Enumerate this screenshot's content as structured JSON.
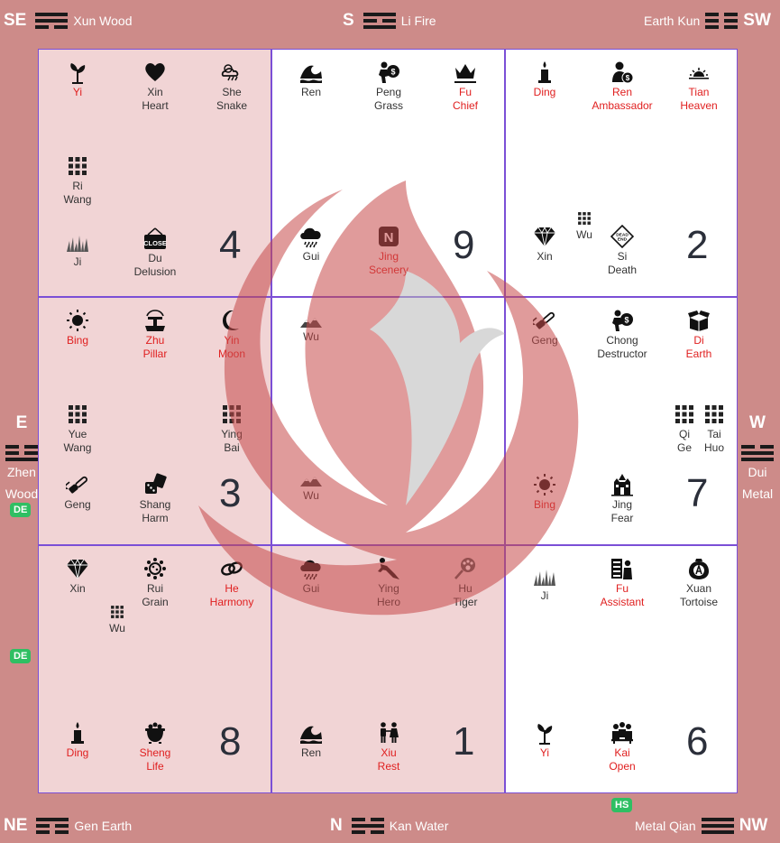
{
  "corners": {
    "se": {
      "dir": "SE",
      "label": "Xun Wood"
    },
    "s": {
      "dir": "S",
      "label": "Li Fire"
    },
    "sw": {
      "dir": "SW",
      "label": "Earth Kun"
    },
    "e": {
      "dir": "E",
      "label1": "Zhen",
      "label2": "Wood"
    },
    "w": {
      "dir": "W",
      "label1": "Dui",
      "label2": "Metal"
    },
    "ne": {
      "dir": "NE",
      "label": "Gen Earth"
    },
    "n": {
      "dir": "N",
      "label": "Kan Water"
    },
    "nw": {
      "dir": "NW",
      "label": "Metal Qian"
    }
  },
  "badges": {
    "de1": "DE",
    "de2": "DE",
    "hs": "HS"
  },
  "colors": {
    "frame": "#cd8b89",
    "pink": "#f1d4d5",
    "border": "#7b4fd6",
    "red": "#e02020",
    "badge": "#2fbf63"
  },
  "cells": {
    "c4": {
      "number": "4",
      "items": {
        "yi": {
          "l1": "Yi",
          "l2": "",
          "icon": "sprout-icon"
        },
        "xin": {
          "l1": "Xin",
          "l2": "Heart",
          "icon": "heart-icon"
        },
        "she": {
          "l1": "She",
          "l2": "Snake",
          "icon": "storm-icon"
        },
        "ri": {
          "l1": "Ri",
          "l2": "Wang",
          "icon": "grid-icon"
        },
        "ji": {
          "l1": "Ji",
          "l2": "",
          "icon": "grass-icon"
        },
        "du": {
          "l1": "Du",
          "l2": "Delusion",
          "icon": "close-sign-icon"
        }
      }
    },
    "c9": {
      "number": "9",
      "items": {
        "ren": {
          "l1": "Ren",
          "l2": "",
          "icon": "wave-icon"
        },
        "peng": {
          "l1": "Peng",
          "l2": "Grass",
          "icon": "thief-icon"
        },
        "fu": {
          "l1": "Fu",
          "l2": "Chief",
          "icon": "crown-icon"
        },
        "gui": {
          "l1": "Gui",
          "l2": "",
          "icon": "rain-icon"
        },
        "jing": {
          "l1": "Jing",
          "l2": "Scenery",
          "icon": "n-icon",
          "nletter": "N"
        }
      }
    },
    "c2": {
      "number": "2",
      "items": {
        "ding": {
          "l1": "Ding",
          "l2": "",
          "icon": "candle-icon"
        },
        "ren": {
          "l1": "Ren",
          "l2": "Ambassador",
          "icon": "person-money-icon"
        },
        "tian": {
          "l1": "Tian",
          "l2": "Heaven",
          "icon": "sunrise-icon"
        },
        "wu": {
          "l1": "Wu",
          "l2": "",
          "icon": "grid-icon"
        },
        "xin": {
          "l1": "Xin",
          "l2": "",
          "icon": "diamond-icon"
        },
        "si": {
          "l1": "Si",
          "l2": "Death",
          "icon": "dead-end-icon",
          "sign1": "DEAD",
          "sign2": "END"
        }
      }
    },
    "c3": {
      "number": "3",
      "items": {
        "bing": {
          "l1": "Bing",
          "l2": "",
          "icon": "sun-icon"
        },
        "zhu": {
          "l1": "Zhu",
          "l2": "Pillar",
          "icon": "fountain-icon"
        },
        "yin": {
          "l1": "Yin",
          "l2": "Moon",
          "icon": "moon-icon"
        },
        "yue": {
          "l1": "Yue",
          "l2": "Wang",
          "icon": "grid-icon"
        },
        "ying": {
          "l1": "Ying",
          "l2": "Bai",
          "icon": "grid-icon"
        },
        "geng": {
          "l1": "Geng",
          "l2": "",
          "icon": "chainsaw-icon"
        },
        "shang": {
          "l1": "Shang",
          "l2": "Harm",
          "icon": "dice-icon"
        }
      }
    },
    "c5": {
      "number": "",
      "items": {
        "wu1": {
          "l1": "Wu",
          "l2": "",
          "icon": "mountain-icon"
        },
        "wu2": {
          "l1": "Wu",
          "l2": "",
          "icon": "mountain-icon"
        }
      }
    },
    "c7": {
      "number": "7",
      "items": {
        "geng": {
          "l1": "Geng",
          "l2": "",
          "icon": "chainsaw-icon"
        },
        "chong": {
          "l1": "Chong",
          "l2": "Destructor",
          "icon": "thief-icon"
        },
        "di": {
          "l1": "Di",
          "l2": "Earth",
          "icon": "box-icon"
        },
        "qi": {
          "l1": "Qi",
          "l2": "Ge",
          "icon": "grid-icon"
        },
        "tai": {
          "l1": "Tai",
          "l2": "Huo",
          "icon": "grid-icon"
        },
        "bing": {
          "l1": "Bing",
          "l2": "",
          "icon": "sun-icon"
        },
        "jing": {
          "l1": "Jing",
          "l2": "Fear",
          "icon": "haunted-icon"
        }
      }
    },
    "c8": {
      "number": "8",
      "items": {
        "xin": {
          "l1": "Xin",
          "l2": "",
          "icon": "diamond-icon"
        },
        "rui": {
          "l1": "Rui",
          "l2": "Grain",
          "icon": "virus-icon"
        },
        "he": {
          "l1": "He",
          "l2": "Harmony",
          "icon": "rings-icon"
        },
        "wu": {
          "l1": "Wu",
          "l2": "",
          "icon": "grid-icon"
        },
        "ding": {
          "l1": "Ding",
          "l2": "",
          "icon": "candle-icon"
        },
        "sheng": {
          "l1": "Sheng",
          "l2": "Life",
          "icon": "cauldron-icon"
        }
      }
    },
    "c1": {
      "number": "1",
      "items": {
        "gui": {
          "l1": "Gui",
          "l2": "",
          "icon": "rain-icon"
        },
        "ying": {
          "l1": "Ying",
          "l2": "Hero",
          "icon": "hero-icon"
        },
        "hu": {
          "l1": "Hu",
          "l2": "Tiger",
          "icon": "paw-icon"
        },
        "ren": {
          "l1": "Ren",
          "l2": "",
          "icon": "wave-icon"
        },
        "xiu": {
          "l1": "Xiu",
          "l2": "Rest",
          "icon": "family-icon"
        }
      }
    },
    "c6": {
      "number": "6",
      "items": {
        "ji": {
          "l1": "Ji",
          "l2": "",
          "icon": "grass-icon"
        },
        "fu": {
          "l1": "Fu",
          "l2": "Assistant",
          "icon": "assistant-icon"
        },
        "xuan": {
          "l1": "Xuan",
          "l2": "Tortoise",
          "icon": "tortoise-icon"
        },
        "yi": {
          "l1": "Yi",
          "l2": "",
          "icon": "sprout-icon"
        },
        "kai": {
          "l1": "Kai",
          "l2": "Open",
          "icon": "group-icon"
        }
      }
    }
  }
}
